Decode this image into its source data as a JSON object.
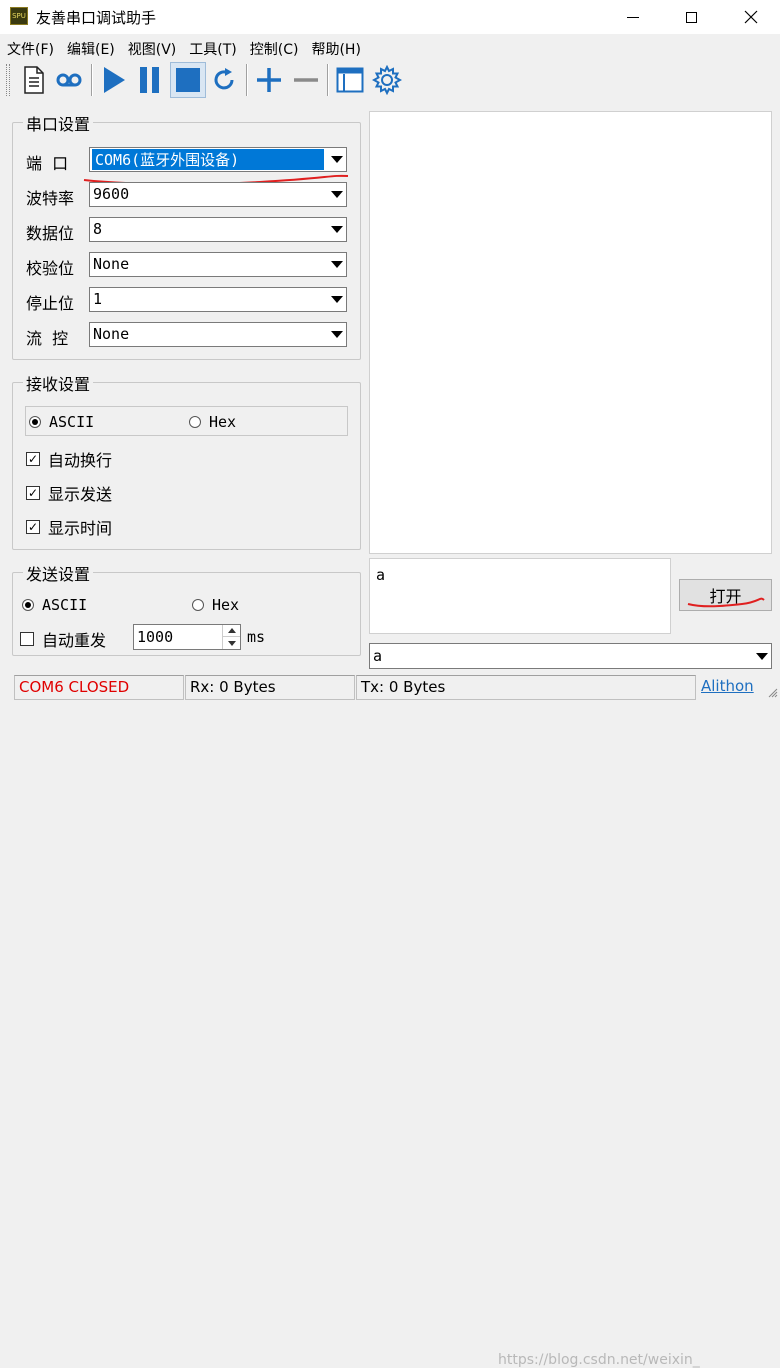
{
  "window": {
    "title": "友善串口调试助手",
    "icon_text": "SPU"
  },
  "menu": [
    "文件(F)",
    "编辑(E)",
    "视图(V)",
    "工具(T)",
    "控制(C)",
    "帮助(H)"
  ],
  "toolbar": {
    "icons": [
      "document-icon",
      "loop-icon",
      "play-icon",
      "pause-icon",
      "stop-icon",
      "refresh-icon",
      "plus-icon",
      "minus-icon",
      "window-icon",
      "gear-icon"
    ]
  },
  "serial": {
    "title": "串口设置",
    "fields": [
      {
        "label": "端  口",
        "value": "COM6(蓝牙外围设备)",
        "selected": true
      },
      {
        "label": "波特率",
        "value": "9600"
      },
      {
        "label": "数据位",
        "value": "8"
      },
      {
        "label": "校验位",
        "value": "None"
      },
      {
        "label": "停止位",
        "value": "1"
      },
      {
        "label": "流  控",
        "value": "None"
      }
    ]
  },
  "receive": {
    "title": "接收设置",
    "ascii": "ASCII",
    "hex": "Hex",
    "checks": [
      "自动换行",
      "显示发送",
      "显示时间"
    ]
  },
  "send": {
    "title": "发送设置",
    "ascii": "ASCII",
    "hex": "Hex",
    "auto_resend": "自动重发",
    "interval": "1000",
    "unit": "ms"
  },
  "send_text": "a",
  "open_button": "打开",
  "history_value": "a",
  "status": {
    "port": "COM6 CLOSED",
    "rx": "Rx: 0 Bytes",
    "tx": "Tx: 0 Bytes",
    "link": "Alithon"
  },
  "watermark": "https://blog.csdn.net/weixin_",
  "colors": {
    "accent": "#0078d7",
    "status_red": "#e00000",
    "annotation_red": "#e02020",
    "icon_blue": "#1e6fc0"
  }
}
